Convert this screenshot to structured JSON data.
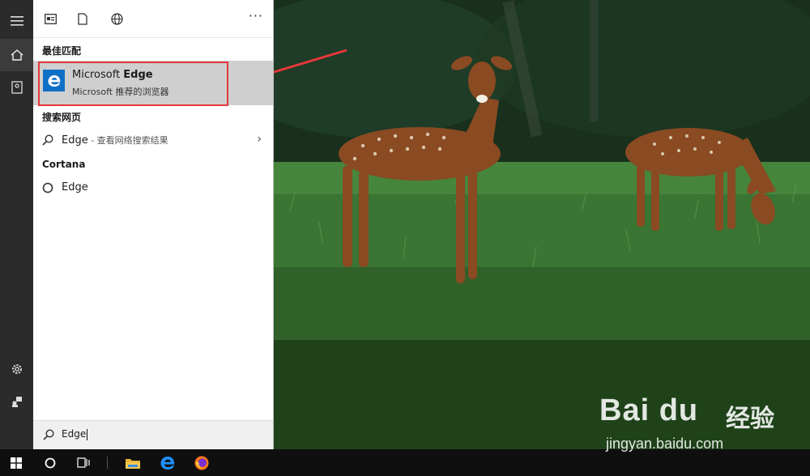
{
  "panel": {
    "more_label": "···",
    "best_match_heading": "最佳匹配",
    "best_match": {
      "title_regular": "Microsoft ",
      "title_bold": "Edge",
      "subtitle": "Microsoft 推荐的浏览器",
      "icon": "edge-icon"
    },
    "web_heading": "搜索网页",
    "web_result": {
      "term": "Edge",
      "suffix": " - 查看网络搜索结果",
      "icon": "search-icon"
    },
    "cortana_heading": "Cortana",
    "cortana_result": {
      "term": "Edge",
      "icon": "cortana-circle-icon"
    }
  },
  "search": {
    "query": "Edge",
    "icon": "search-icon"
  },
  "rail": {
    "icons": [
      "hamburger-menu-icon",
      "home-icon",
      "notebook-icon",
      "gear-icon",
      "feedback-icon"
    ]
  },
  "taskbar": {
    "icons": [
      "windows-start-icon",
      "cortana-icon",
      "task-view-icon",
      "file-explorer-icon",
      "edge-icon",
      "firefox-icon"
    ]
  },
  "watermark": {
    "logo": "Bai du",
    "cn": "经验",
    "url": "jingyan.baidu.com"
  },
  "colors": {
    "highlight": "#e5383b",
    "edge_blue": "#0f6fc6",
    "rail_bg": "#2b2b2b",
    "best_match_bg": "#cfcfcf"
  }
}
